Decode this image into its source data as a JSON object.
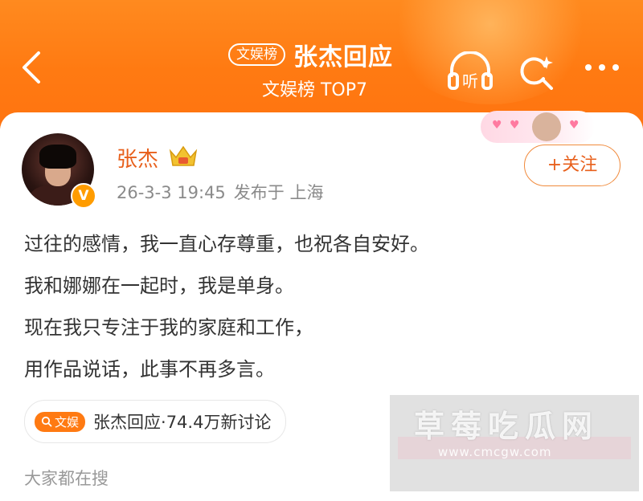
{
  "header": {
    "category_tag": "文娱榜",
    "title": "张杰回应",
    "subtitle": "文娱榜 TOP7",
    "listen_label": "听",
    "icons": [
      "back-arrow-icon",
      "listen-icon",
      "search-sparkle-icon",
      "more-icon"
    ],
    "accent": "#ff7a12"
  },
  "post": {
    "username": "张杰",
    "timestamp": "26-3-3 19:45",
    "location": "发布于 上海",
    "verified_mark": "V",
    "follow_label": "+关注",
    "lines": [
      "过往的感情，我一直心存尊重，也祝各自安好。",
      "我和娜娜在一起时，我是单身。",
      "现在我只专注于我的家庭和工作，",
      "用作品说话，此事不再多言。"
    ],
    "name_color": "#e8601c"
  },
  "topic": {
    "badge": "文娱",
    "text": "张杰回应·74.4万新讨论"
  },
  "search_section": {
    "label": "大家都在搜"
  },
  "watermark": {
    "title": "草莓吃瓜网",
    "url": "www.cmcgw.com"
  }
}
